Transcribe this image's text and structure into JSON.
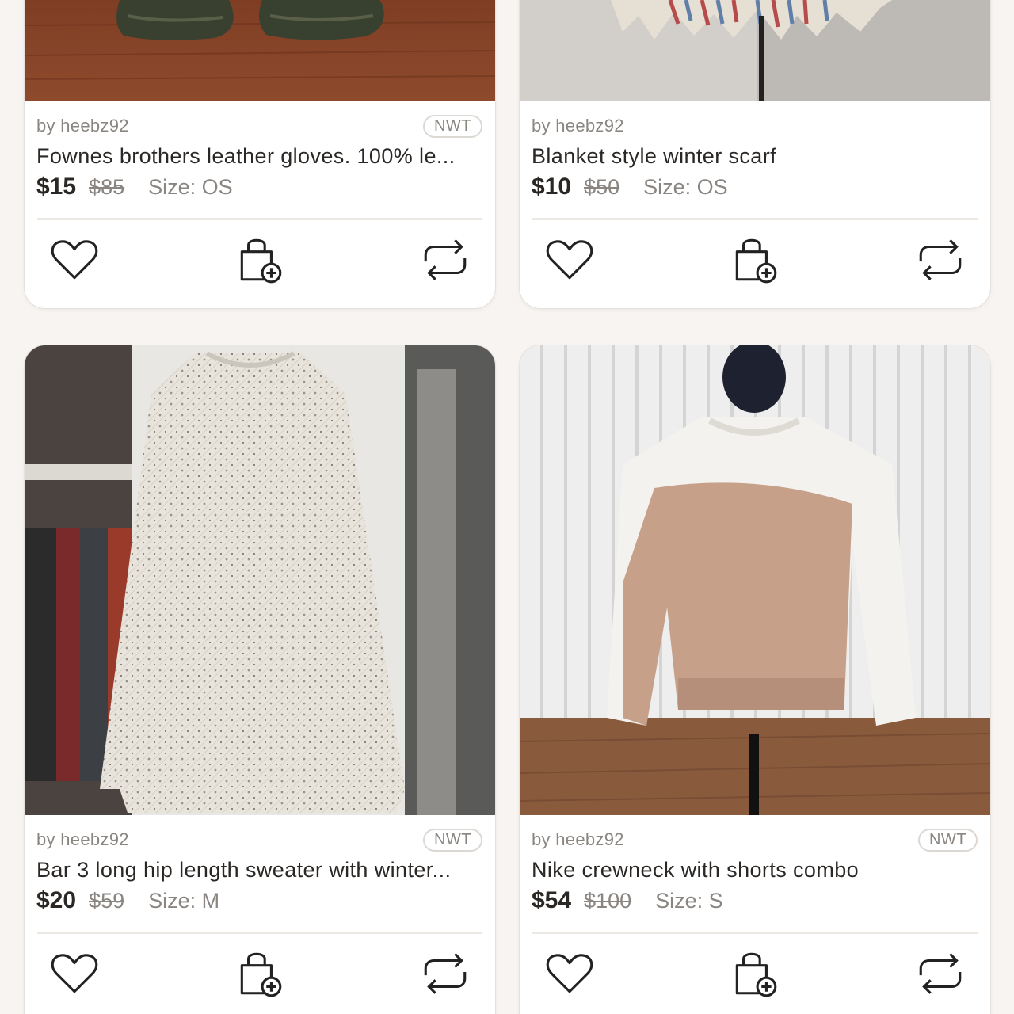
{
  "listings": [
    {
      "seller": "by heebz92",
      "badge": "NWT",
      "title": "Fownes brothers leather gloves. 100% le...",
      "price": "$15",
      "original_price": "$85",
      "size": "Size: OS"
    },
    {
      "seller": "by heebz92",
      "badge": "",
      "title": "Blanket style winter scarf",
      "price": "$10",
      "original_price": "$50",
      "size": "Size: OS"
    },
    {
      "seller": "by heebz92",
      "badge": "NWT",
      "title": "Bar 3 long hip length sweater with winter...",
      "price": "$20",
      "original_price": "$59",
      "size": "Size: M"
    },
    {
      "seller": "by heebz92",
      "badge": "NWT",
      "title": "Nike crewneck with shorts combo",
      "price": "$54",
      "original_price": "$100",
      "size": "Size: S"
    }
  ],
  "action_icons": [
    "heart-icon",
    "shopping-bag-add-icon",
    "share-repost-icon"
  ],
  "colors": {
    "background": "#f7f4f1",
    "card": "#ffffff",
    "muted_text": "#8a8580",
    "primary_text": "#2a2724"
  }
}
